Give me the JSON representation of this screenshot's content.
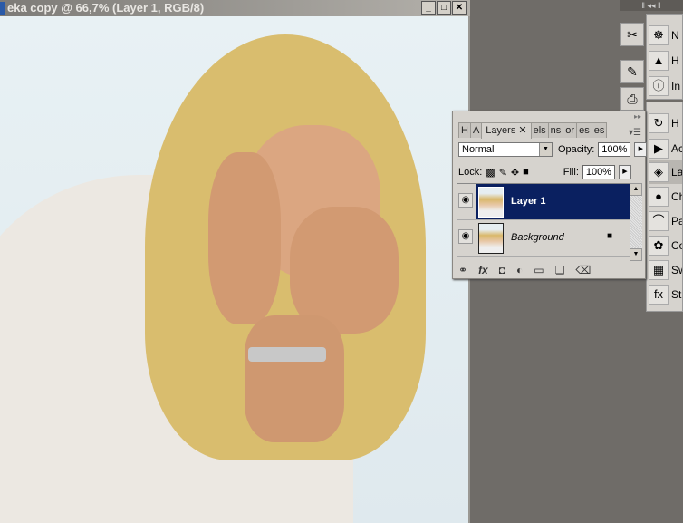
{
  "document": {
    "title": "eka copy @ 66,7% (Layer 1, RGB/8)",
    "window_buttons": [
      "_",
      "□",
      "✕"
    ]
  },
  "layers_panel": {
    "tabs": [
      "H",
      "A",
      "Layers",
      "els",
      "ns",
      "or",
      "es",
      "es"
    ],
    "active_tab": "Layers",
    "blend_mode": "Normal",
    "opacity_label": "Opacity:",
    "opacity": "100%",
    "lock_label": "Lock:",
    "fill_label": "Fill:",
    "fill": "100%",
    "layers": [
      {
        "name": "Layer 1",
        "selected": true,
        "visible": true
      },
      {
        "name": "Background",
        "selected": false,
        "visible": true,
        "locked": true
      }
    ],
    "footer_icons": [
      "link-icon",
      "fx-icon",
      "mask-icon",
      "adjustment-icon",
      "folder-icon",
      "new-layer-icon",
      "trash-icon"
    ],
    "selection_color": "#0a2060"
  },
  "dock": {
    "group1": [
      "N",
      "H",
      "In"
    ],
    "group2": [
      "H",
      "Ac",
      "La",
      "Ch",
      "Pa",
      "Co",
      "Sw",
      "St"
    ],
    "selected": "La"
  }
}
